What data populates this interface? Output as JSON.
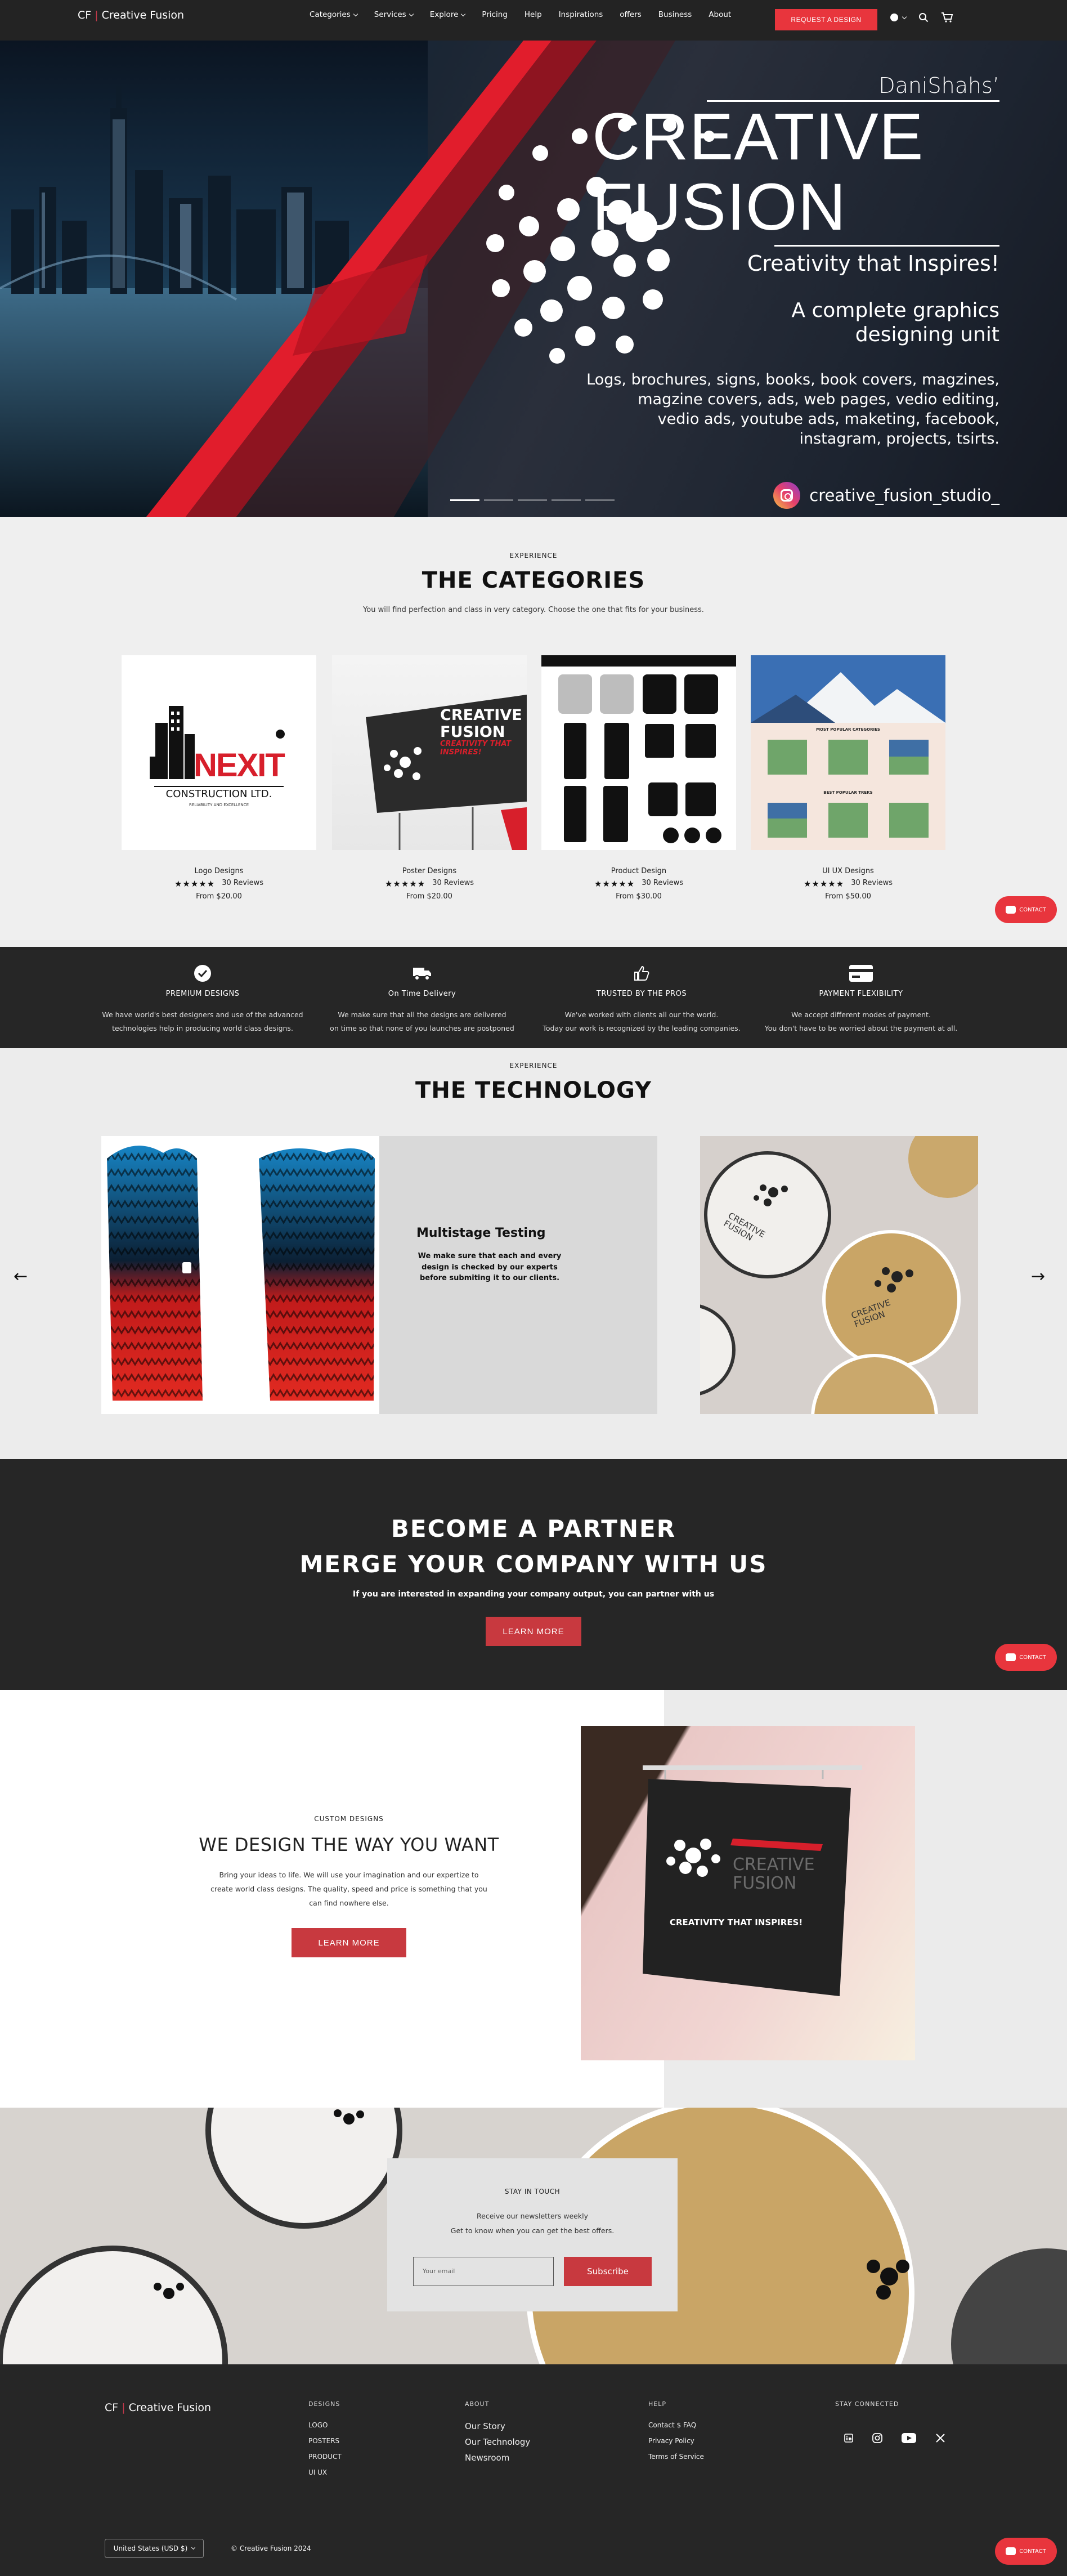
{
  "nav": {
    "brand_short": "CF",
    "brand_sep": "|",
    "brand_name": "Creative Fusion",
    "links": [
      "Categories",
      "Services",
      "Explore",
      "Pricing",
      "Help",
      "Inspirations",
      "offers",
      "Business",
      "About"
    ],
    "request_button": "REQUEST A DESIGN"
  },
  "hero": {
    "author": "DaniShahs’",
    "title_line1": "CREATIVE",
    "title_line2": "FUSION",
    "tagline": "Creativity that Inspires!",
    "unit_line1": "A complete graphics",
    "unit_line2": "designing unit",
    "desc_line1": "Logs, brochures, signs, books, book covers, magzines,",
    "desc_line2": "magzine covers, ads, web pages, vedio editing,",
    "desc_line3": "vedio ads, youtube ads, maketing, facebook,",
    "desc_line4": "instagram, projects, tsirts.",
    "instagram_handle": "creative_fusion_studio_"
  },
  "categories": {
    "kicker": "EXPERIENCE",
    "title": "THE CATEGORIES",
    "subtitle": "You will find perfection and class in very category. Choose the one that fits for your business.",
    "items": [
      {
        "name": "Logo Designs",
        "stars": "★★★★★",
        "reviews": "30 Reviews",
        "price": "From $20.00"
      },
      {
        "name": "Poster Designs",
        "stars": "★★★★★",
        "reviews": "30 Reviews",
        "price": "From $20.00"
      },
      {
        "name": "Product Design",
        "stars": "★★★★★",
        "reviews": "30 Reviews",
        "price": "From $30.00"
      },
      {
        "name": "UI UX Designs",
        "stars": "★★★★★",
        "reviews": "30 Reviews",
        "price": "From $50.00"
      }
    ],
    "logo_card": {
      "brand": "NEXIT",
      "sub": "CONSTRUCTION LTD.",
      "tag": "RELIABILITY AND EXCELLENCE"
    },
    "poster_card": {
      "l1": "CREATIVE",
      "l2": "FUSION",
      "l3": "CREATIVITY THAT",
      "l4": "INSPIRES!"
    },
    "uiux_card": {
      "h1": "MOST POPULAR CATEGORIES",
      "h2": "BEST POPULAR TREKS"
    }
  },
  "contact_label": "CONTACT",
  "features": [
    {
      "title": "PREMIUM DESIGNS",
      "line1": "We have world's best designers and use of the advanced",
      "line2": "technologies help in producing world class designs."
    },
    {
      "title": "On Time Delivery",
      "line1": "We make sure that all the designs are delivered",
      "line2": "on time so that none of you launches are postponed"
    },
    {
      "title": "TRUSTED BY THE PROS",
      "line1": "We've worked with clients all our the world.",
      "line2": "Today our work is recognized by the leading companies."
    },
    {
      "title": "PAYMENT FLEXIBILITY",
      "line1": "We accept different modes of payment.",
      "line2": "You don't have to be worried about the payment at all."
    }
  ],
  "technology": {
    "kicker": "EXPERIENCE",
    "title": "THE TECHNOLOGY",
    "slide_title": "Multistage Testing",
    "slide_line1": "We make sure that each and every",
    "slide_line2": "design is checked by our experts",
    "slide_line3": "before submiting it to our clients.",
    "sticker_l1": "CREATIVE",
    "sticker_l2": "FUSION"
  },
  "partner": {
    "line1": "BECOME A PARTNER",
    "line2": "MERGE YOUR COMPANY WITH US",
    "desc": "If you are interested in expanding your company output, you can partner with us",
    "button": "LEARN MORE"
  },
  "design_way": {
    "kicker": "CUSTOM DESIGNS",
    "title": "WE DESIGN THE WAY YOU WANT",
    "line1": "Bring your ideas to life. We will use your imagination and our expertize to",
    "line2": "create world class designs. The quality, speed and price is something that you",
    "line3": "can find nowhere else.",
    "button": "LEARN MORE",
    "sign_l1": "CREATIVE",
    "sign_l2": "FUSION",
    "sign_l3": "CREATIVITY THAT INSPIRES!"
  },
  "newsletter": {
    "kicker": "STAY IN TOUCH",
    "line1": "Receive our newsletters weekly",
    "line2": "Get to know when you can get the best offers.",
    "placeholder": "Your email",
    "button": "Subscribe"
  },
  "footer": {
    "brand_short": "CF",
    "brand_sep": "|",
    "brand_name": "Creative Fusion",
    "designs_h": "DESIGNS",
    "designs": [
      "LOGO",
      "POSTERS",
      "PRODUCT",
      "UI UX"
    ],
    "about_h": "ABOUT",
    "about": [
      "Our Story",
      "Our Technology",
      "Newsroom"
    ],
    "help_h": "HELP",
    "help": [
      "Contact $ FAQ",
      "Privacy Policy",
      "Terms of Service"
    ],
    "connected_h": "STAY CONNECTED",
    "currency": "United States (USD $)",
    "copyright": "© Creative Fusion 2024"
  },
  "colors": {
    "accent": "#e8353d",
    "dark": "#262626",
    "button": "#c8393f"
  }
}
